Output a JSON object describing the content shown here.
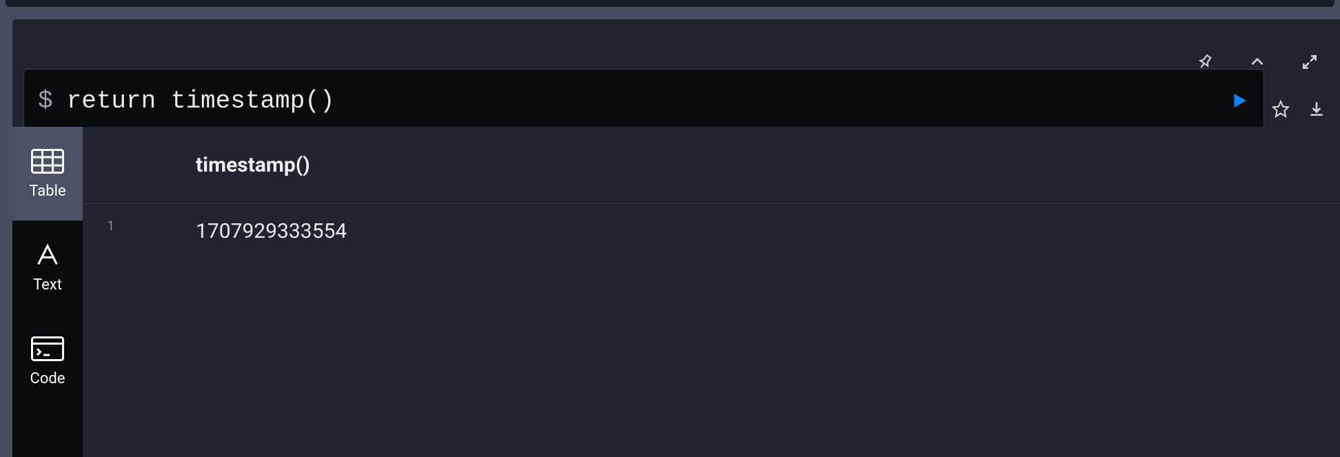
{
  "query": {
    "prompt_symbol": "$",
    "text": "return timestamp()"
  },
  "sidebar": {
    "tabs": [
      {
        "label": "Table"
      },
      {
        "label": "Text"
      },
      {
        "label": "Code"
      }
    ]
  },
  "results": {
    "header": "timestamp()",
    "rows": [
      {
        "num": "1",
        "value": "1707929333554"
      }
    ]
  }
}
